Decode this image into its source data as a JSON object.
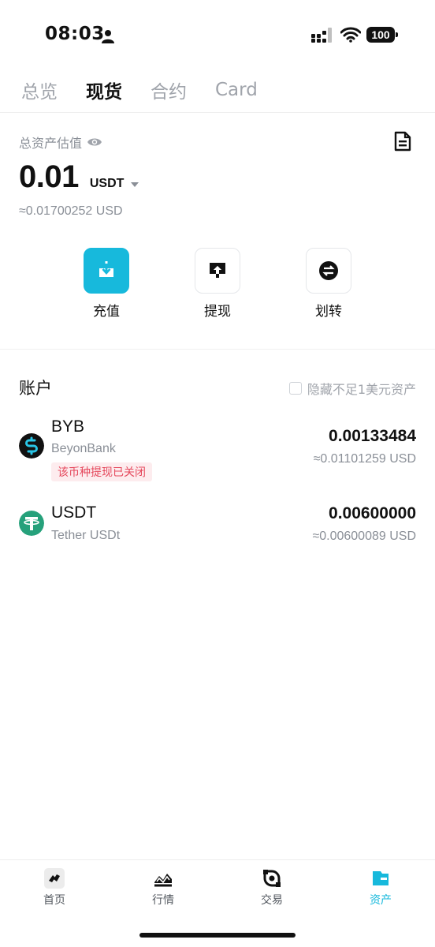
{
  "status_bar": {
    "time": "08:03",
    "battery": "100"
  },
  "tabs": [
    {
      "label": "总览",
      "active": false
    },
    {
      "label": "现货",
      "active": true
    },
    {
      "label": "合约",
      "active": false
    },
    {
      "label": "Card",
      "active": false
    }
  ],
  "summary": {
    "label": "总资产估值",
    "balance": "0.01",
    "unit": "USDT",
    "approx_usd": "≈0.01700252 USD"
  },
  "actions": [
    {
      "label": "充值",
      "icon": "deposit-icon"
    },
    {
      "label": "提现",
      "icon": "withdraw-icon"
    },
    {
      "label": "划转",
      "icon": "transfer-icon"
    }
  ],
  "accounts": {
    "title": "账户",
    "hide_small_label": "隐藏不足1美元资产",
    "hide_small_checked": false,
    "items": [
      {
        "symbol": "BYB",
        "name": "BeyonBank",
        "badge": "该币种提现已关闭",
        "amount": "0.00133484",
        "usd": "≈0.01101259  USD",
        "logo_color": "#111111"
      },
      {
        "symbol": "USDT",
        "name": "Tether USDt",
        "amount": "0.00600000",
        "usd": "≈0.00600089  USD",
        "logo_color": "#26a17b"
      }
    ]
  },
  "bottom_nav": [
    {
      "label": "首页",
      "icon": "home-icon",
      "active": false
    },
    {
      "label": "行情",
      "icon": "market-icon",
      "active": false
    },
    {
      "label": "交易",
      "icon": "trade-icon",
      "active": false
    },
    {
      "label": "资产",
      "icon": "wallet-icon",
      "active": true
    }
  ],
  "colors": {
    "accent": "#17b9dc",
    "warning_text": "#e5485c",
    "warning_bg": "#fdecee",
    "muted": "#8a8f97"
  }
}
